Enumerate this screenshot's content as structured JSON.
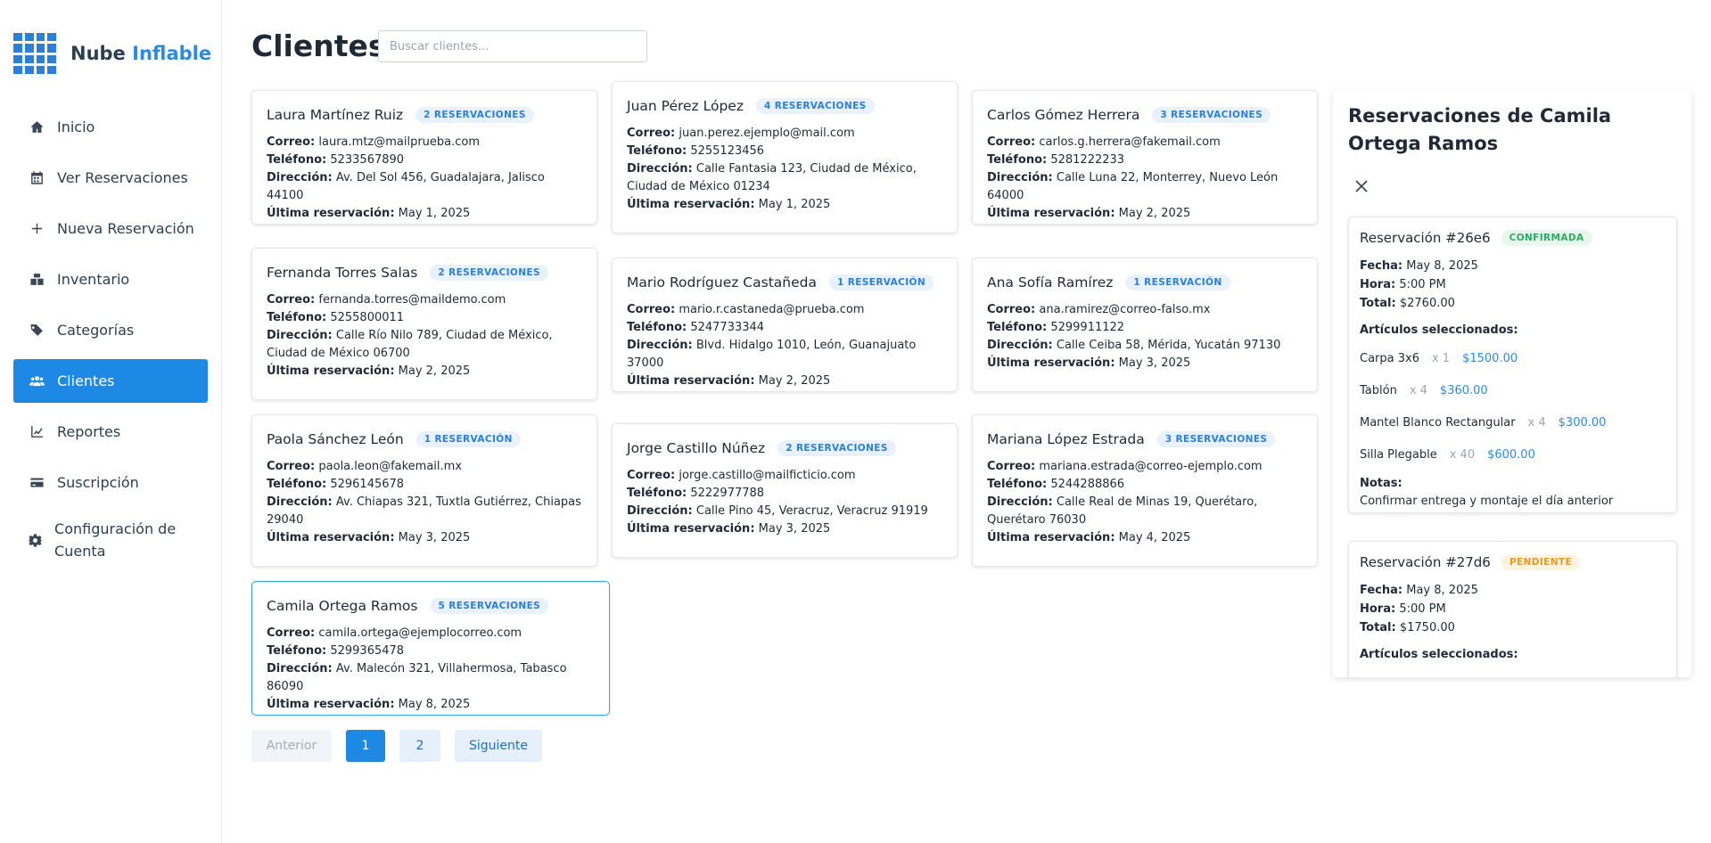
{
  "app": {
    "brand_main": "Nube",
    "brand_accent": "Inflable"
  },
  "sidebar": {
    "items": [
      {
        "label": "Inicio",
        "icon": "home-icon"
      },
      {
        "label": "Ver Reservaciones",
        "icon": "calendar-icon"
      },
      {
        "label": "Nueva Reservación",
        "icon": "plus-icon"
      },
      {
        "label": "Inventario",
        "icon": "boxes-icon"
      },
      {
        "label": "Categorías",
        "icon": "tags-icon"
      },
      {
        "label": "Clientes",
        "icon": "users-icon"
      },
      {
        "label": "Reportes",
        "icon": "chart-line-icon"
      },
      {
        "label": "Suscripción",
        "icon": "credit-card-icon"
      },
      {
        "label": "Configuración de Cuenta",
        "icon": "gear-icon"
      }
    ]
  },
  "header": {
    "title": "Clientes",
    "search_placeholder": "Buscar clientes..."
  },
  "labels": {
    "email": "Correo:",
    "phone": "Teléfono:",
    "address": "Dirección:",
    "last": "Última reservación:"
  },
  "clients": [
    {
      "name": "Laura Martínez Ruiz",
      "badge": "2 RESERVACIONES",
      "email": "laura.mtz@mailprueba.com",
      "phone": "5233567890",
      "address": "Av. Del Sol 456, Guadalajara, Jalisco 44100",
      "last": "May 1, 2025"
    },
    {
      "name": "Juan Pérez López",
      "badge": "4 RESERVACIONES",
      "email": "juan.perez.ejemplo@mail.com",
      "phone": "5255123456",
      "address": "Calle Fantasia 123, Ciudad de México, Ciudad de México 01234",
      "last": "May 1, 2025"
    },
    {
      "name": "Carlos Gómez Herrera",
      "badge": "3 RESERVACIONES",
      "email": "carlos.g.herrera@fakemail.com",
      "phone": "5281222233",
      "address": "Calle Luna 22, Monterrey, Nuevo León 64000",
      "last": "May 2, 2025"
    },
    {
      "name": "Fernanda Torres Salas",
      "badge": "2 RESERVACIONES",
      "email": "fernanda.torres@maildemo.com",
      "phone": "5255800011",
      "address": "Calle Río Nilo 789, Ciudad de México, Ciudad de México 06700",
      "last": "May 2, 2025"
    },
    {
      "name": "Mario Rodríguez Castañeda",
      "badge": "1 RESERVACIÓN",
      "email": "mario.r.castaneda@prueba.com",
      "phone": "5247733344",
      "address": "Blvd. Hidalgo 1010, León, Guanajuato 37000",
      "last": "May 2, 2025"
    },
    {
      "name": "Ana Sofía Ramírez",
      "badge": "1 RESERVACIÓN",
      "email": "ana.ramirez@correo-falso.mx",
      "phone": "5299911122",
      "address": "Calle Ceiba 58, Mérida, Yucatán 97130",
      "last": "May 3, 2025"
    },
    {
      "name": "Paola Sánchez León",
      "badge": "1 RESERVACIÓN",
      "email": "paola.leon@fakemail.mx",
      "phone": "5296145678",
      "address": "Av. Chiapas 321, Tuxtla Gutiérrez, Chiapas 29040",
      "last": "May 3, 2025"
    },
    {
      "name": "Jorge Castillo Núñez",
      "badge": "2 RESERVACIONES",
      "email": "jorge.castillo@mailficticio.com",
      "phone": "5222977788",
      "address": "Calle Pino 45, Veracruz, Veracruz 91919",
      "last": "May 3, 2025"
    },
    {
      "name": "Mariana López Estrada",
      "badge": "3 RESERVACIONES",
      "email": "mariana.estrada@correo-ejemplo.com",
      "phone": "5244288866",
      "address": "Calle Real de Minas 19, Querétaro, Querétaro 76030",
      "last": "May 4, 2025"
    },
    {
      "name": "Camila Ortega Ramos",
      "badge": "5 RESERVACIONES",
      "email": "camila.ortega@ejemplocorreo.com",
      "phone": "5299365478",
      "address": "Av. Malecón 321, Villahermosa, Tabasco 86090",
      "last": "May 8, 2025"
    }
  ],
  "pagination": {
    "prev": "Anterior",
    "pages": [
      "1",
      "2"
    ],
    "next": "Siguiente",
    "current": "1"
  },
  "panel": {
    "title": "Reservaciones de Camila Ortega Ramos",
    "labels": {
      "date": "Fecha:",
      "time": "Hora:",
      "total": "Total:",
      "items": "Artículos seleccionados:",
      "notes": "Notas:"
    },
    "reservations": [
      {
        "id": "Reservación #26e6",
        "status": "CONFIRMADA",
        "date": "May 8, 2025",
        "time": "5:00 PM",
        "total": "$2760.00",
        "items": [
          {
            "name": "Carpa 3x6",
            "qty": "x 1",
            "price": "$1500.00"
          },
          {
            "name": "Tablón",
            "qty": "x 4",
            "price": "$360.00"
          },
          {
            "name": "Mantel Blanco Rectangular",
            "qty": "x 4",
            "price": "$300.00"
          },
          {
            "name": "Silla Plegable",
            "qty": "x 40",
            "price": "$600.00"
          }
        ],
        "notes": "Confirmar entrega y montaje el día anterior"
      },
      {
        "id": "Reservación #27d6",
        "status": "PENDIENTE",
        "date": "May 8, 2025",
        "time": "5:00 PM",
        "total": "$1750.00"
      }
    ]
  },
  "colors": {
    "accent": "#1e88e5",
    "confirmed": "#27ae60",
    "pending": "#e69b1e"
  }
}
